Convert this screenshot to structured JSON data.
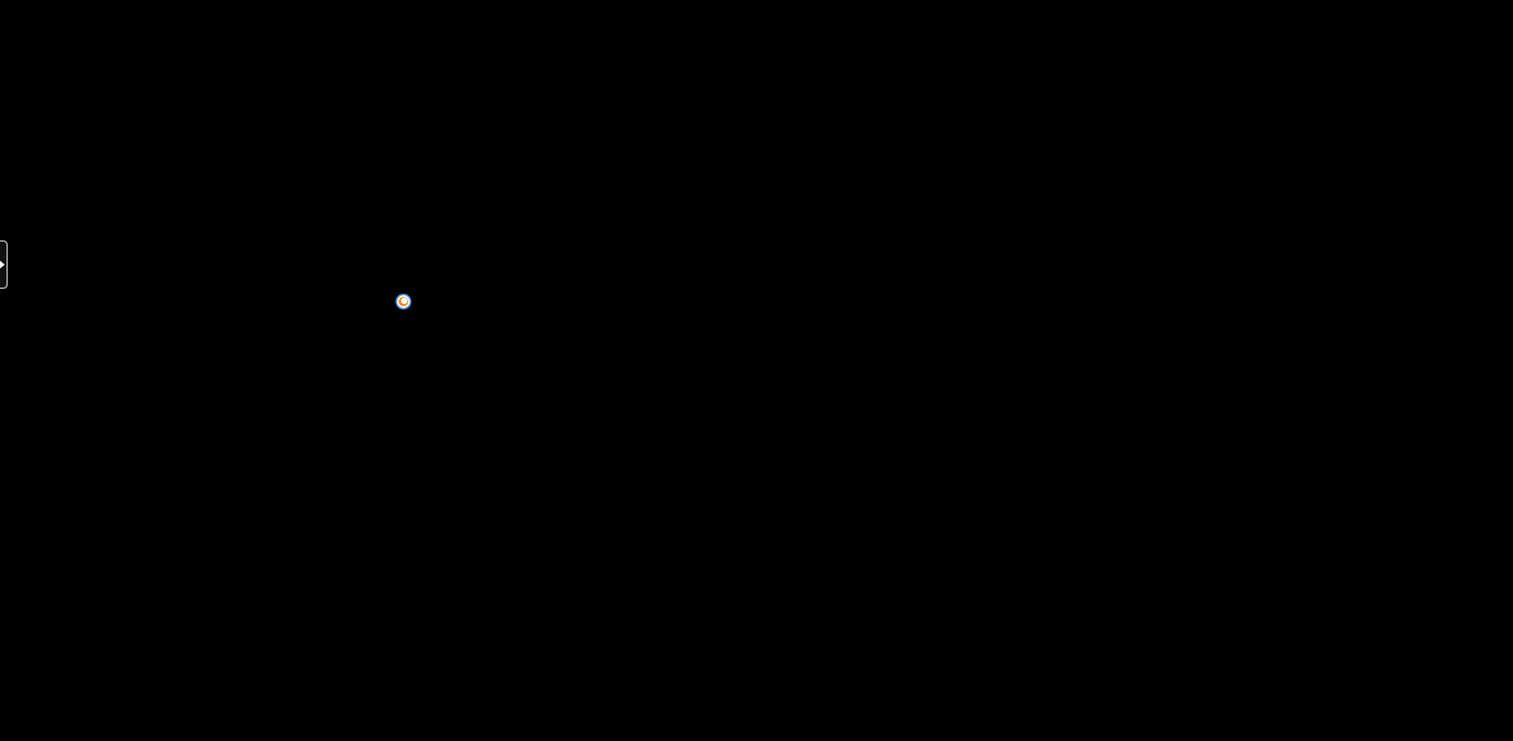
{
  "screen": {
    "background_color": "#000000"
  },
  "side_toggle": {
    "icon": "chevron-right-icon",
    "border_color": "#9a9a9a",
    "arrow_color": "#ffffff"
  },
  "marker": {
    "icon": "cursor-dot-icon",
    "outer_color": "#4a9be8",
    "ring_color": "#ffffff",
    "core_color": "#f28c28"
  }
}
